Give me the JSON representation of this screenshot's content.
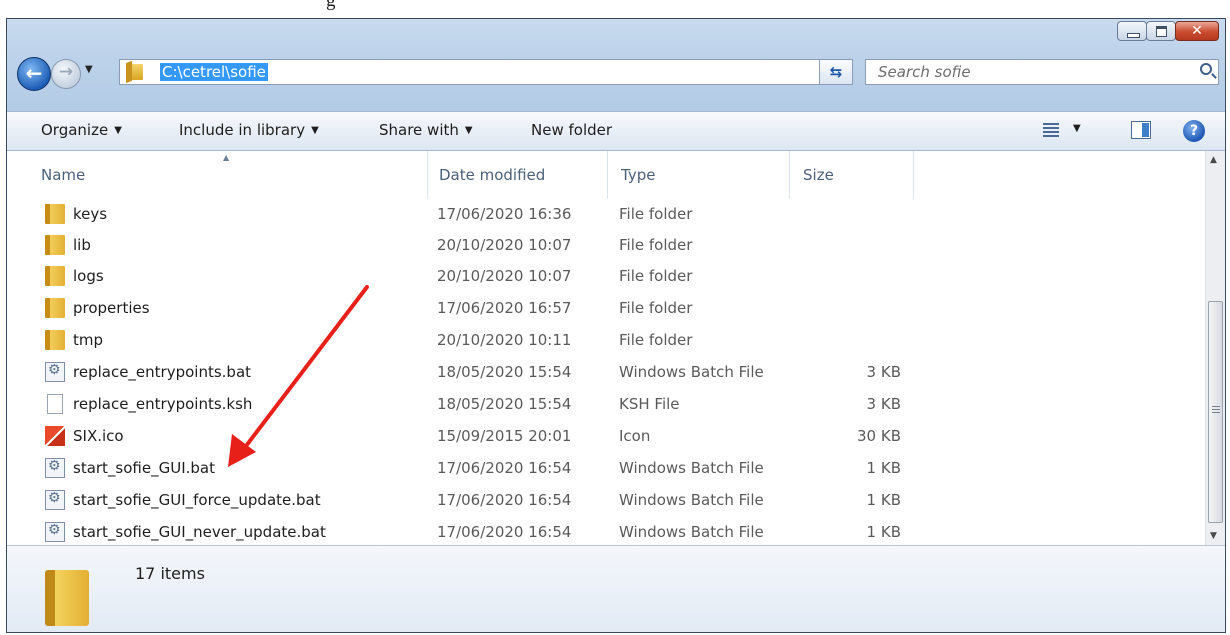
{
  "caption_fragment": "g",
  "window": {
    "close_glyph": "✕"
  },
  "nav": {
    "address_path": "C:\\cetrel\\sofie",
    "search_placeholder": "Search sofie"
  },
  "toolbar": {
    "organize": "Organize",
    "include_in_library": "Include in library",
    "share_with": "Share with",
    "new_folder": "New folder",
    "help_glyph": "?"
  },
  "columns": {
    "name": "Name",
    "date_modified": "Date modified",
    "type": "Type",
    "size": "Size"
  },
  "files": [
    {
      "icon": "folder-icon",
      "name": "keys",
      "date": "17/06/2020 16:36",
      "type": "File folder",
      "size": ""
    },
    {
      "icon": "folder-icon",
      "name": "lib",
      "date": "20/10/2020 10:07",
      "type": "File folder",
      "size": ""
    },
    {
      "icon": "folder-icon",
      "name": "logs",
      "date": "20/10/2020 10:07",
      "type": "File folder",
      "size": ""
    },
    {
      "icon": "folder-icon",
      "name": "properties",
      "date": "17/06/2020 16:57",
      "type": "File folder",
      "size": ""
    },
    {
      "icon": "folder-icon",
      "name": "tmp",
      "date": "20/10/2020 10:11",
      "type": "File folder",
      "size": ""
    },
    {
      "icon": "batch-file-icon",
      "name": "replace_entrypoints.bat",
      "date": "18/05/2020 15:54",
      "type": "Windows Batch File",
      "size": "3 KB"
    },
    {
      "icon": "blank-file-icon",
      "name": "replace_entrypoints.ksh",
      "date": "18/05/2020 15:54",
      "type": "KSH File",
      "size": "3 KB"
    },
    {
      "icon": "ico-file-icon",
      "name": "SIX.ico",
      "date": "15/09/2015 20:01",
      "type": "Icon",
      "size": "30 KB"
    },
    {
      "icon": "batch-file-icon",
      "name": "start_sofie_GUI.bat",
      "date": "17/06/2020 16:54",
      "type": "Windows Batch File",
      "size": "1 KB"
    },
    {
      "icon": "batch-file-icon",
      "name": "start_sofie_GUI_force_update.bat",
      "date": "17/06/2020 16:54",
      "type": "Windows Batch File",
      "size": "1 KB"
    },
    {
      "icon": "batch-file-icon",
      "name": "start_sofie_GUI_never_update.bat",
      "date": "17/06/2020 16:54",
      "type": "Windows Batch File",
      "size": "1 KB"
    }
  ],
  "details": {
    "item_count": "17 items"
  },
  "colors": {
    "selection": "#3399ff",
    "annotation_arrow": "#e8201a"
  }
}
